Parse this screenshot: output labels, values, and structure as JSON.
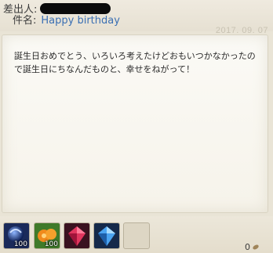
{
  "header": {
    "sender_label": "差出人:",
    "subject_label": "件名:",
    "subject_value": "Happy birthday"
  },
  "letter": {
    "date": "2017. 09. 07",
    "body": "誕生日おめでとう、いろいろ考えたけどおもいつかなかったので誕生日にちなんだものと、幸せをねがって！"
  },
  "attachments": [
    {
      "icon": "blue-orb-icon",
      "quantity": "100"
    },
    {
      "icon": "orange-fruit-icon",
      "quantity": "100"
    },
    {
      "icon": "red-gem-icon",
      "quantity": ""
    },
    {
      "icon": "blue-gem-icon",
      "quantity": ""
    },
    {
      "icon": "empty-slot",
      "quantity": ""
    }
  ],
  "gold": {
    "amount": "0",
    "icon": "coin-icon"
  }
}
